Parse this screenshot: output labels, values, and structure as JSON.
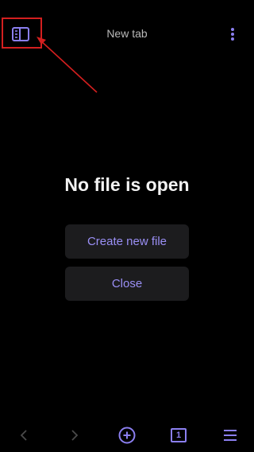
{
  "header": {
    "title": "New tab"
  },
  "empty_state": {
    "message": "No file is open",
    "create_label": "Create new file",
    "close_label": "Close"
  },
  "bottom_bar": {
    "tab_count": "1"
  },
  "icons": {
    "sidebar": "sidebar-toggle-icon",
    "more": "more-vertical-icon",
    "back": "chevron-left-icon",
    "forward": "chevron-right-icon",
    "new_tab": "plus-circle-icon",
    "tabs": "tab-count-icon",
    "menu": "hamburger-menu-icon"
  },
  "colors": {
    "background": "#000000",
    "accent": "#8b7ff0",
    "button_bg": "#1c1c1e",
    "annotation": "#d31f1f"
  }
}
